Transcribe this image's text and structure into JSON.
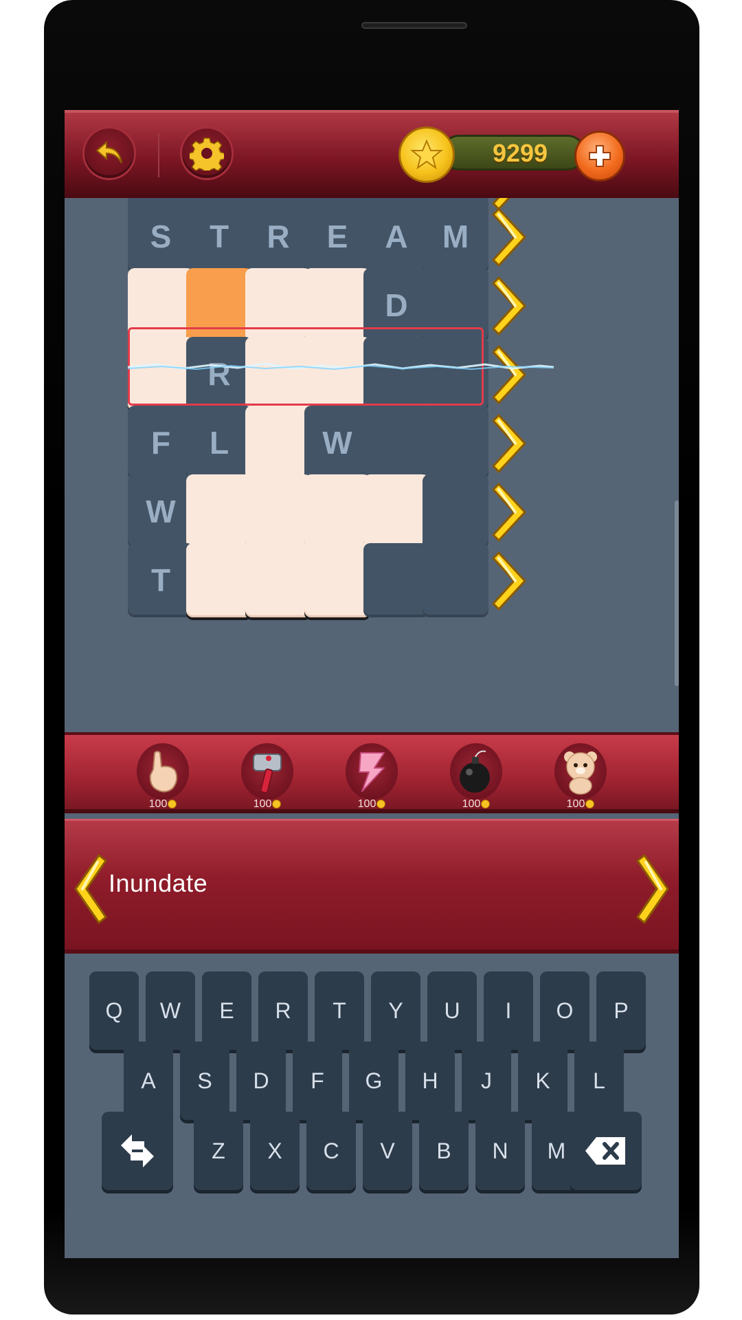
{
  "header": {
    "back_icon": "back-arrow-icon",
    "settings_icon": "gear-icon",
    "coins": "9299",
    "coin_icon": "star-coin-icon",
    "add_icon": "plus-icon"
  },
  "grid": {
    "rows": [
      {
        "cells": [
          "",
          "",
          "",
          "",
          "",
          ""
        ],
        "partial": true
      },
      {
        "cells": [
          "S",
          "T",
          "R",
          "E",
          "A",
          "M"
        ]
      },
      {
        "cells": [
          "",
          "",
          "",
          "",
          "D",
          ""
        ],
        "filled": [
          true,
          true,
          true,
          true,
          false,
          false
        ],
        "active_index": 1,
        "selected": true
      },
      {
        "cells": [
          "",
          "R",
          "",
          "",
          "",
          ""
        ],
        "filled": [
          true,
          false,
          true,
          true,
          false,
          false
        ]
      },
      {
        "cells": [
          "F",
          "L",
          "",
          "W",
          "",
          ""
        ],
        "filled": [
          false,
          false,
          true,
          false,
          false,
          false
        ]
      },
      {
        "cells": [
          "W",
          "",
          "",
          "",
          "",
          ""
        ],
        "filled": [
          false,
          true,
          true,
          true,
          true,
          false
        ]
      },
      {
        "cells": [
          "T",
          "",
          "",
          "",
          "",
          ""
        ],
        "filled": [
          false,
          true,
          true,
          true,
          false,
          false
        ]
      }
    ],
    "accent_color": "#f99e4c"
  },
  "powerups": [
    {
      "name": "hint",
      "icon": "pointing-finger-icon",
      "cost": "100"
    },
    {
      "name": "hammer",
      "icon": "hammer-icon",
      "cost": "100"
    },
    {
      "name": "lightning",
      "icon": "lightning-icon",
      "cost": "100"
    },
    {
      "name": "bomb",
      "icon": "bomb-icon",
      "cost": "100"
    },
    {
      "name": "bear",
      "icon": "teddy-bear-icon",
      "cost": "100"
    }
  ],
  "clue": {
    "text": "Inundate",
    "prev_icon": "chevron-left-icon",
    "next_icon": "chevron-right-icon"
  },
  "keyboard": {
    "row1": [
      "Q",
      "W",
      "E",
      "R",
      "T",
      "Y",
      "U",
      "I",
      "O",
      "P"
    ],
    "row2": [
      "A",
      "S",
      "D",
      "F",
      "G",
      "H",
      "J",
      "K",
      "L"
    ],
    "row3": [
      "Z",
      "X",
      "C",
      "V",
      "B",
      "N",
      "M"
    ],
    "swap_icon": "swap-arrows-icon",
    "backspace_icon": "backspace-icon"
  }
}
